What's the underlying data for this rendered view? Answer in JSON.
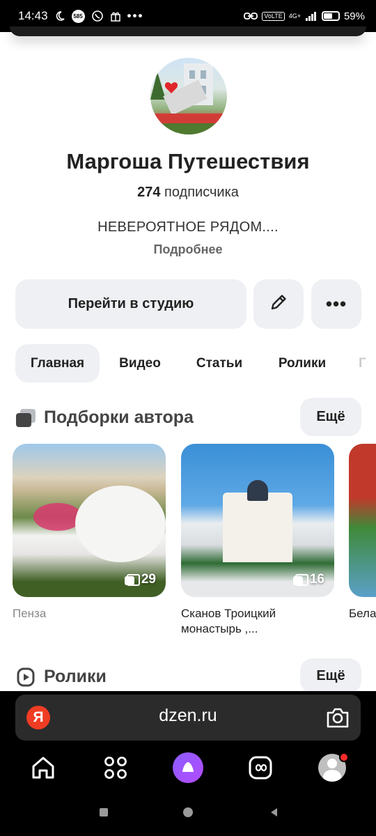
{
  "status_bar": {
    "time": "14:43",
    "badge": "585",
    "network": "4G+",
    "volte": "VoLTE",
    "battery": "59%"
  },
  "profile": {
    "name": "Маргоша Путешествия",
    "subscribers_count": "274",
    "subscribers_label": "подписчика",
    "description": "НЕВЕРОЯТНОЕ РЯДОМ....",
    "more_link": "Подробнее"
  },
  "actions": {
    "studio_label": "Перейти в студию",
    "edit_icon": "pencil-icon",
    "more_icon": "ellipsis-icon",
    "more_glyph": "•••"
  },
  "tabs": [
    {
      "label": "Главная",
      "active": true
    },
    {
      "label": "Видео",
      "active": false
    },
    {
      "label": "Статьи",
      "active": false
    },
    {
      "label": "Ролики",
      "active": false
    }
  ],
  "collections": {
    "title": "Подборки автора",
    "more_label": "Ещё",
    "cards": [
      {
        "count": "29",
        "caption": "Пенза"
      },
      {
        "count": "16",
        "caption": "Сканов Троицкий монастырь ,..."
      },
      {
        "caption": "Бела"
      }
    ]
  },
  "shorts": {
    "title": "Ролики",
    "more_label": "Ещё"
  },
  "browser": {
    "logo": "Я",
    "url": "dzen.ru"
  },
  "colors": {
    "chip_bg": "#eef0f3",
    "yandex_red": "#f03c24",
    "alice_purple": "#8b5cff",
    "notification_red": "#ff2b2b"
  }
}
